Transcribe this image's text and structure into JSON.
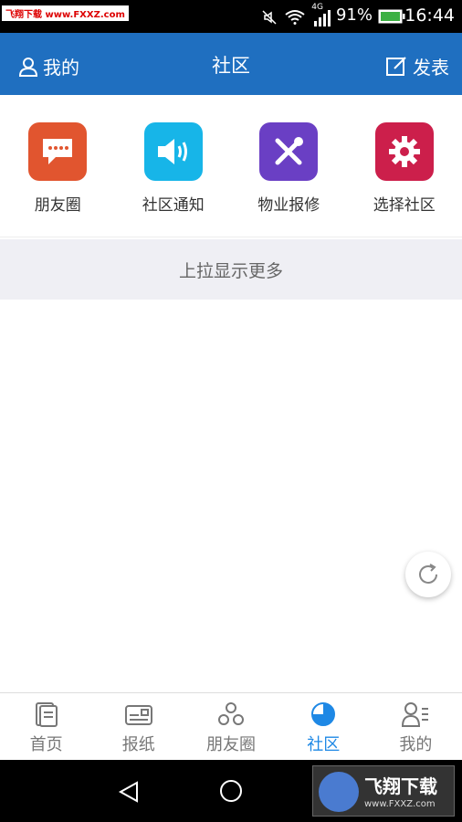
{
  "status_bar": {
    "watermark": "飞翔下载 www.FXXZ.com",
    "network": "4G",
    "battery": "91%",
    "time": "16:44"
  },
  "header": {
    "left_label": "我的",
    "title": "社区",
    "right_label": "发表"
  },
  "actions": [
    {
      "label": "朋友圈",
      "icon": "chat-bubble-icon",
      "color": "#e1552f"
    },
    {
      "label": "社区通知",
      "icon": "speaker-icon",
      "color": "#17b5e8"
    },
    {
      "label": "物业报修",
      "icon": "tools-icon",
      "color": "#6a3fc4"
    },
    {
      "label": "选择社区",
      "icon": "gear-icon",
      "color": "#cc1f4b"
    }
  ],
  "pull_more": "上拉显示更多",
  "tabs": [
    {
      "label": "首页",
      "icon": "document-icon",
      "active": false
    },
    {
      "label": "报纸",
      "icon": "newspaper-icon",
      "active": false
    },
    {
      "label": "朋友圈",
      "icon": "circle-people-icon",
      "active": false
    },
    {
      "label": "社区",
      "icon": "pie-chart-icon",
      "active": true
    },
    {
      "label": "我的",
      "icon": "profile-icon",
      "active": false
    }
  ],
  "watermark_bottom": {
    "title": "飞翔下载",
    "url": "www.FXXZ.com"
  },
  "colors": {
    "header": "#1f6fc0",
    "active_tab": "#1e88e5",
    "pull_bg": "#efeff4"
  }
}
